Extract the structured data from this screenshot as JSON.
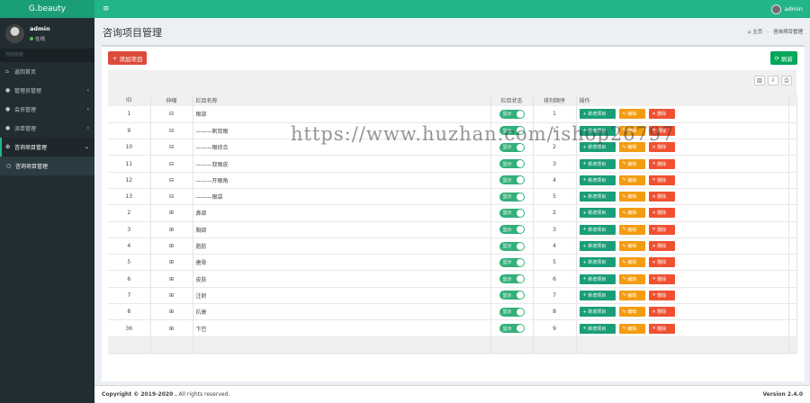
{
  "app": {
    "logo": "G.beauty"
  },
  "header": {
    "menu_icon": "hamburger-icon",
    "user_name": "admin"
  },
  "sidebar": {
    "user": {
      "name": "admin",
      "status": "在线"
    },
    "nav_header": "控制面板",
    "items": [
      {
        "icon": "home-icon",
        "label": "返回首页",
        "has_arrow": false
      },
      {
        "icon": "admin-user-icon",
        "label": "管理员管理",
        "has_arrow": true
      },
      {
        "icon": "members-icon",
        "label": "会员管理",
        "has_arrow": true
      },
      {
        "icon": "orders-icon",
        "label": "派单管理",
        "has_arrow": true
      },
      {
        "icon": "gear-icon",
        "label": "咨询项目管理",
        "has_arrow": true,
        "active": true
      }
    ],
    "submenu": {
      "icon": "circle-icon",
      "label": "咨询项目管理"
    }
  },
  "main": {
    "title": "咨询项目管理",
    "breadcrumb": {
      "home": "主页",
      "current": "咨询项目管理"
    }
  },
  "toolbar": {
    "add_label": "添加项目",
    "refresh_label": "刷新"
  },
  "table": {
    "columns": [
      "ID",
      "伸缩",
      "栏目名称",
      "栏目状态",
      "排列顺序",
      "操作"
    ],
    "rows": [
      {
        "id": "1",
        "expand": "⊟",
        "name": "眼部",
        "status": "显示",
        "order": "1"
      },
      {
        "id": "9",
        "expand": "⊟",
        "name": "———割双眼",
        "status": "显示",
        "order": "1"
      },
      {
        "id": "10",
        "expand": "⊟",
        "name": "———眼综合",
        "status": "显示",
        "order": "2"
      },
      {
        "id": "11",
        "expand": "⊟",
        "name": "———双眼皮",
        "status": "显示",
        "order": "3"
      },
      {
        "id": "12",
        "expand": "⊟",
        "name": "———开眼角",
        "status": "显示",
        "order": "4"
      },
      {
        "id": "13",
        "expand": "⊟",
        "name": "———眼袋",
        "status": "显示",
        "order": "5"
      },
      {
        "id": "2",
        "expand": "⊞",
        "name": "鼻部",
        "status": "显示",
        "order": "2"
      },
      {
        "id": "3",
        "expand": "⊞",
        "name": "胸部",
        "status": "显示",
        "order": "3"
      },
      {
        "id": "4",
        "expand": "⊞",
        "name": "脂肪",
        "status": "显示",
        "order": "4"
      },
      {
        "id": "5",
        "expand": "⊞",
        "name": "唐骨",
        "status": "显示",
        "order": "5"
      },
      {
        "id": "6",
        "expand": "⊞",
        "name": "皮肤",
        "status": "显示",
        "order": "6"
      },
      {
        "id": "7",
        "expand": "⊞",
        "name": "注射",
        "status": "显示",
        "order": "7"
      },
      {
        "id": "8",
        "expand": "⊞",
        "name": "抗衰",
        "status": "显示",
        "order": "8"
      },
      {
        "id": "36",
        "expand": "⊞",
        "name": "下巴",
        "status": "显示",
        "order": "9"
      }
    ],
    "actions": {
      "new": "新增项目",
      "edit": "编辑",
      "delete": "删除"
    }
  },
  "watermark": "https://www.huzhan.com/ishop26797",
  "footer": {
    "copyright": "Copyright © 2019-2020 .",
    "rights": "All rights reserved.",
    "version": "Version 2.4.0"
  },
  "colors": {
    "header": "#22b58a",
    "logo_bg": "#1a9e77",
    "sidebar": "#222d32",
    "add": "#dd4b39",
    "refresh": "#00a65a",
    "edit": "#f39c12",
    "delete": "#f05030"
  }
}
